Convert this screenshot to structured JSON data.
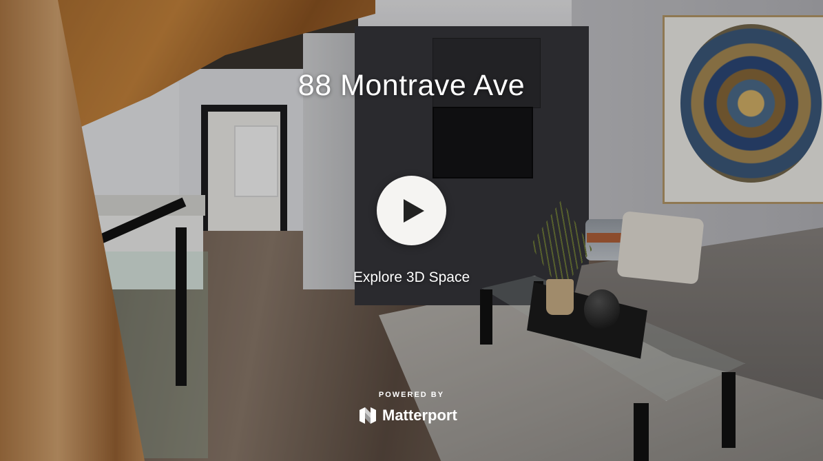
{
  "tour": {
    "title": "88 Montrave Ave",
    "explore_label": "Explore 3D Space",
    "play_icon": "play-icon"
  },
  "branding": {
    "powered_by": "POWERED BY",
    "brand_name": "Matterport",
    "logo_icon": "matterport-logo-icon"
  },
  "colors": {
    "play_button_bg": "#f5f4f2",
    "play_glyph": "#222222",
    "text": "#ffffff"
  }
}
